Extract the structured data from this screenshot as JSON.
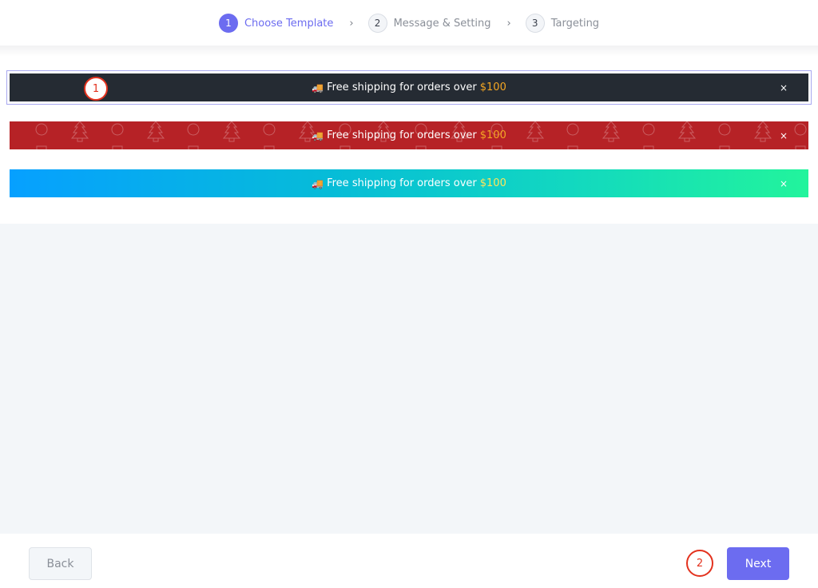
{
  "stepper": {
    "steps": [
      {
        "number": "1",
        "label": "Choose Template",
        "active": true
      },
      {
        "number": "2",
        "label": "Message & Setting",
        "active": false
      },
      {
        "number": "3",
        "label": "Targeting",
        "active": false
      }
    ],
    "separator": "›"
  },
  "templates": [
    {
      "name": "dark",
      "icon": "truck-icon",
      "icon_glyph": "🚚",
      "text": "Free shipping for orders over",
      "amount": "$100",
      "close": "×",
      "background": "#252b33",
      "selected": true
    },
    {
      "name": "christmas",
      "icon": "truck-icon",
      "icon_glyph": "🚚",
      "text": "Free shipping for orders over",
      "amount": "$100",
      "close": "×",
      "background": "#b62226",
      "selected": false
    },
    {
      "name": "gradient",
      "icon": "truck-icon",
      "icon_glyph": "🚚",
      "text": "Free shipping for orders over",
      "amount": "$100",
      "close": "×",
      "background": "linear-gradient #06a0ff → #22f49c",
      "selected": false
    }
  ],
  "annotations": {
    "first": "1",
    "second": "2"
  },
  "footer": {
    "back_label": "Back",
    "next_label": "Next"
  },
  "colors": {
    "accent": "#6c6cf0",
    "amount": "#f4a623",
    "annotation": "#e3321e"
  }
}
